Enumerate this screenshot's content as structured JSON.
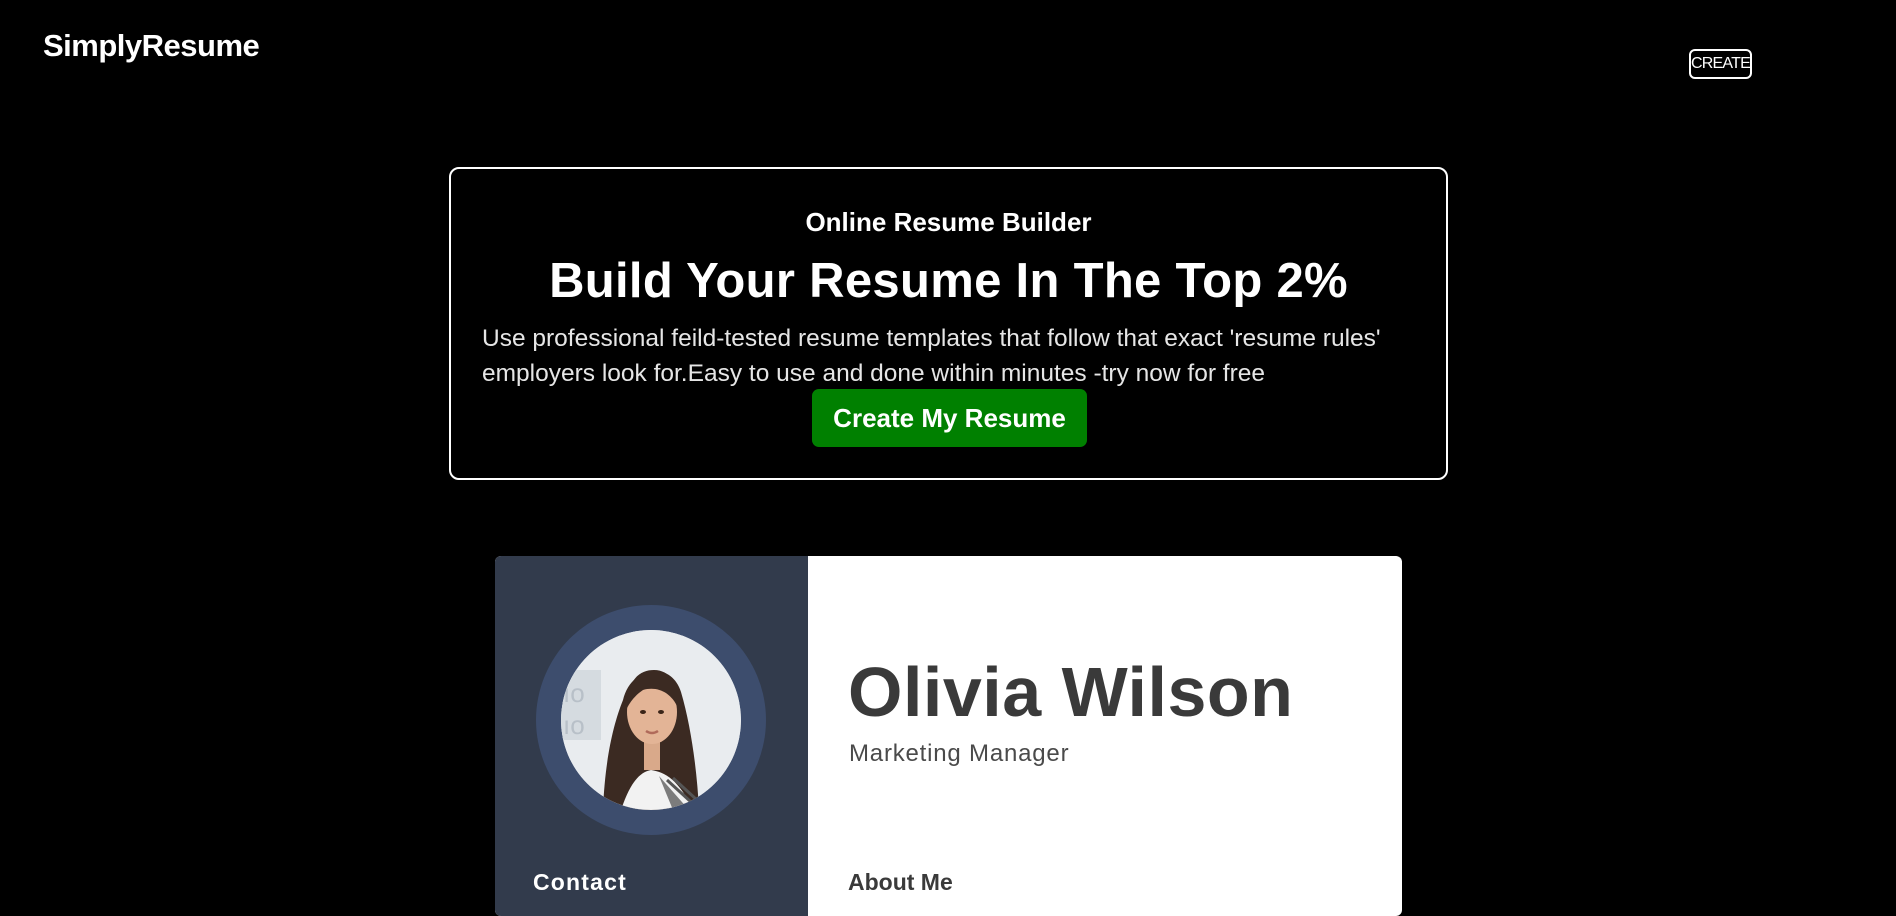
{
  "nav": {
    "logo": "SimplyResume",
    "create_label": "CREATE"
  },
  "hero": {
    "subtitle": "Online Resume Builder",
    "title": "Build Your Resume In The Top 2%",
    "description": "Use professional feild-tested resume templates that follow that exact 'resume rules' employers look for.Easy to use and done within minutes -try now for free",
    "cta_label": "Create My Resume"
  },
  "resume_preview": {
    "name": "Olivia Wilson",
    "role": "Marketing Manager",
    "contact_heading": "Contact",
    "about_heading": "About Me"
  },
  "colors": {
    "background": "#000000",
    "cta": "#008000",
    "resume_sidebar": "#323b4c",
    "avatar_ring": "#3d4d6d"
  }
}
